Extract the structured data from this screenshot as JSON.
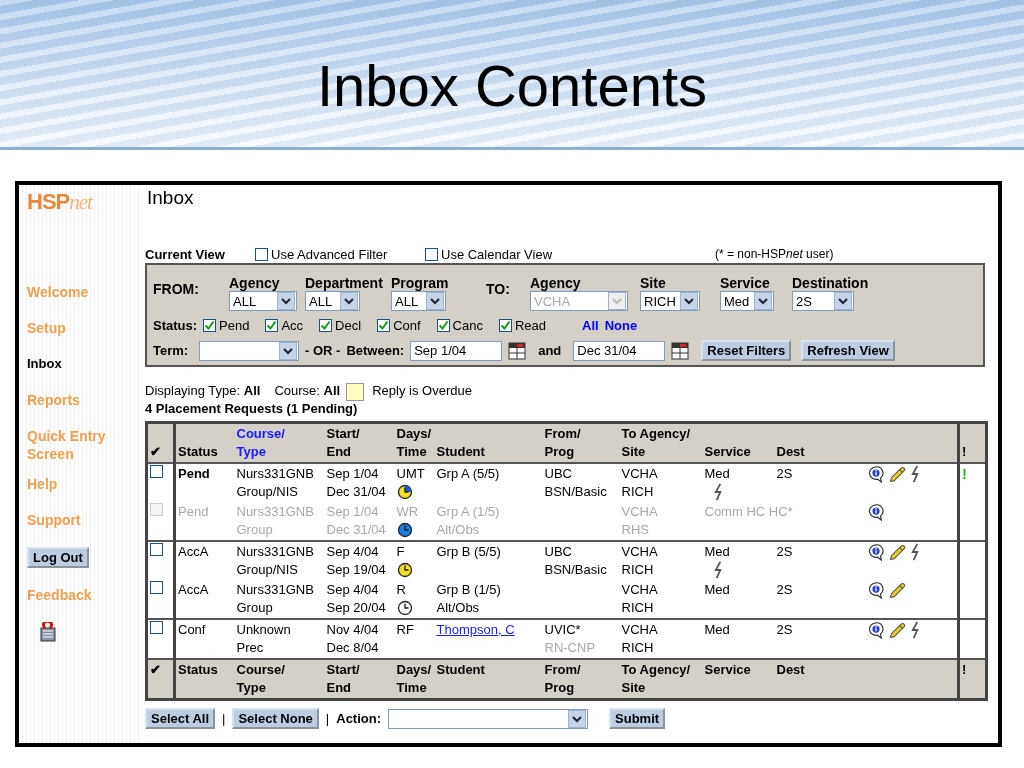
{
  "slide_title": "Inbox Contents",
  "sidebar": {
    "logo": {
      "main": "HSP",
      "suffix": "net"
    },
    "items": [
      {
        "label": "Welcome",
        "selected": false
      },
      {
        "label": "Setup",
        "selected": false
      },
      {
        "label": "Inbox",
        "selected": true
      },
      {
        "label": "Reports",
        "selected": false
      },
      {
        "label": "Quick Entry Screen",
        "selected": false
      },
      {
        "label": "Help",
        "selected": false
      },
      {
        "label": "Support",
        "selected": false
      }
    ],
    "logout": "Log Out",
    "feedback": "Feedback"
  },
  "page_title": "Inbox",
  "view": {
    "label": "Current View",
    "options": [
      {
        "label": "Use Advanced Filter",
        "checked": false
      },
      {
        "label": "Use Calendar View",
        "checked": false
      }
    ],
    "note": {
      "before": "(* = non-HSP",
      "italic": "net",
      "after": "user)"
    }
  },
  "filters": {
    "from_label": "FROM:",
    "from": [
      {
        "label": "Agency",
        "value": "ALL",
        "disabled": false
      },
      {
        "label": "Department",
        "value": "ALL",
        "disabled": false
      },
      {
        "label": "Program",
        "value": "ALL",
        "disabled": false
      }
    ],
    "to_label": "TO:",
    "to": [
      {
        "label": "Agency",
        "value": "VCHA",
        "disabled": true
      },
      {
        "label": "Site",
        "value": "RICH",
        "disabled": false
      },
      {
        "label": "Service",
        "value": "Med",
        "disabled": false
      },
      {
        "label": "Destination",
        "value": "2S",
        "disabled": false
      }
    ],
    "status_label": "Status:",
    "statuses": [
      {
        "label": "Pend",
        "checked": true
      },
      {
        "label": "Acc",
        "checked": true
      },
      {
        "label": "Decl",
        "checked": true
      },
      {
        "label": "Conf",
        "checked": true
      },
      {
        "label": "Canc",
        "checked": true
      },
      {
        "label": "Read",
        "checked": true
      }
    ],
    "all_link": "All",
    "none_link": "None",
    "term_label": "Term:",
    "or_label": "- OR -",
    "between_label": "Between:",
    "start_date": "Sep 1/04",
    "and_label": "and",
    "end_date": "Dec 31/04",
    "buttons": [
      "Reset Filters",
      "Refresh View"
    ]
  },
  "summary": {
    "type_label": "Displaying Type:",
    "type_value": "All",
    "course_label": "Course:",
    "course_value": "All",
    "legend": "Reply is Overdue",
    "count": "4 Placement Requests (1 Pending)"
  },
  "columns": [
    {
      "lines": [
        "✔"
      ]
    },
    {
      "lines": [
        "Status"
      ]
    },
    {
      "lines": [
        "Course/",
        "Type"
      ],
      "link": true
    },
    {
      "lines": [
        "Start/",
        "End"
      ]
    },
    {
      "lines": [
        "Days/",
        "Time"
      ]
    },
    {
      "lines": [
        "Student"
      ]
    },
    {
      "lines": [
        "From/",
        "Prog"
      ]
    },
    {
      "lines": [
        "To Agency/",
        "Site"
      ]
    },
    {
      "lines": [
        "Service"
      ]
    },
    {
      "lines": [
        "Dest"
      ]
    },
    {
      "lines": [
        "!"
      ]
    }
  ],
  "groups": [
    {
      "rows": [
        {
          "checked": false,
          "disabled": false,
          "emphasis": true,
          "status": "Pend",
          "course": [
            "Nurs331GNB",
            "Group/NIS"
          ],
          "dates": [
            "Sep 1/04",
            "Dec 31/04"
          ],
          "days": "UMT",
          "clock": {
            "color": "#f4e01c",
            "split": true
          },
          "student": [
            "Grp A (5/5)"
          ],
          "from": {
            "agency": "UBC",
            "program": "BSN/Basic"
          },
          "to": [
            "VCHA",
            "RICH"
          ],
          "service": "Med",
          "service_flag": true,
          "dest": "2S",
          "info": true,
          "edit": true,
          "quick": true,
          "alert": "!"
        },
        {
          "checked": false,
          "disabled": true,
          "emphasis": false,
          "status": "Pend",
          "course": [
            "Nurs331GNB",
            "Group"
          ],
          "dates": [
            "Sep 1/04",
            "Dec 31/04"
          ],
          "days": "WR",
          "clock": {
            "color": "#1a7fe0"
          },
          "student": [
            "Grp A (1/5)",
            "Alt/Obs"
          ],
          "to": [
            "VCHA",
            "RHS"
          ],
          "service": "Comm HC HC*",
          "info": true
        }
      ]
    },
    {
      "rows": [
        {
          "checked": false,
          "disabled": false,
          "emphasis": false,
          "status": "AccA",
          "course": [
            "Nurs331GNB",
            "Group/NIS"
          ],
          "dates": [
            "Sep 4/04",
            "Sep 19/04"
          ],
          "days": "F",
          "clock": {
            "color": "#f4e01c"
          },
          "student": [
            "Grp B (5/5)"
          ],
          "from": {
            "agency": "UBC",
            "program": "BSN/Basic"
          },
          "to": [
            "VCHA",
            "RICH"
          ],
          "service": "Med",
          "service_flag": true,
          "dest": "2S",
          "info": true,
          "edit": true,
          "quick": true
        },
        {
          "checked": false,
          "disabled": false,
          "emphasis": false,
          "status": "AccA",
          "course": [
            "Nurs331GNB",
            "Group"
          ],
          "dates": [
            "Sep 4/04",
            "Sep 20/04"
          ],
          "days": "R",
          "clock": {
            "color": "#ffffff"
          },
          "student": [
            "Grp B (1/5)",
            "Alt/Obs"
          ],
          "to": [
            "VCHA",
            "RICH"
          ],
          "service": "Med",
          "dest": "2S",
          "info": true,
          "edit": true
        }
      ]
    },
    {
      "rows": [
        {
          "checked": false,
          "disabled": false,
          "emphasis": false,
          "status": "Conf",
          "course": [
            "Unknown",
            "Prec"
          ],
          "dates": [
            "Nov 4/04",
            "Dec 8/04"
          ],
          "days": "RF",
          "student": [
            "Thompson, C"
          ],
          "student_link": true,
          "from": {
            "agency": "UVIC*",
            "program": "RN-CNP",
            "program_muted": true
          },
          "to": [
            "VCHA",
            "RICH"
          ],
          "service": "Med",
          "dest": "2S",
          "info": true,
          "edit": true,
          "quick": true
        }
      ]
    }
  ],
  "footer_columns": [
    {
      "lines": [
        "✔"
      ]
    },
    {
      "lines": [
        "Status"
      ]
    },
    {
      "lines": [
        "Course/",
        "Type"
      ]
    },
    {
      "lines": [
        "Start/",
        "End"
      ]
    },
    {
      "lines": [
        "Days/",
        "Time"
      ]
    },
    {
      "lines": [
        "Student"
      ]
    },
    {
      "lines": [
        "From/",
        "Prog"
      ]
    },
    {
      "lines": [
        "To Agency/",
        "Site"
      ]
    },
    {
      "lines": [
        "Service"
      ]
    },
    {
      "lines": [
        "Dest"
      ]
    },
    {
      "lines": [
        "!"
      ]
    }
  ],
  "actions": {
    "select_all": "Select All",
    "separator_1": "|",
    "select_none": "Select None",
    "separator_2": "|",
    "action_label": "Action:",
    "submit": "Submit"
  }
}
